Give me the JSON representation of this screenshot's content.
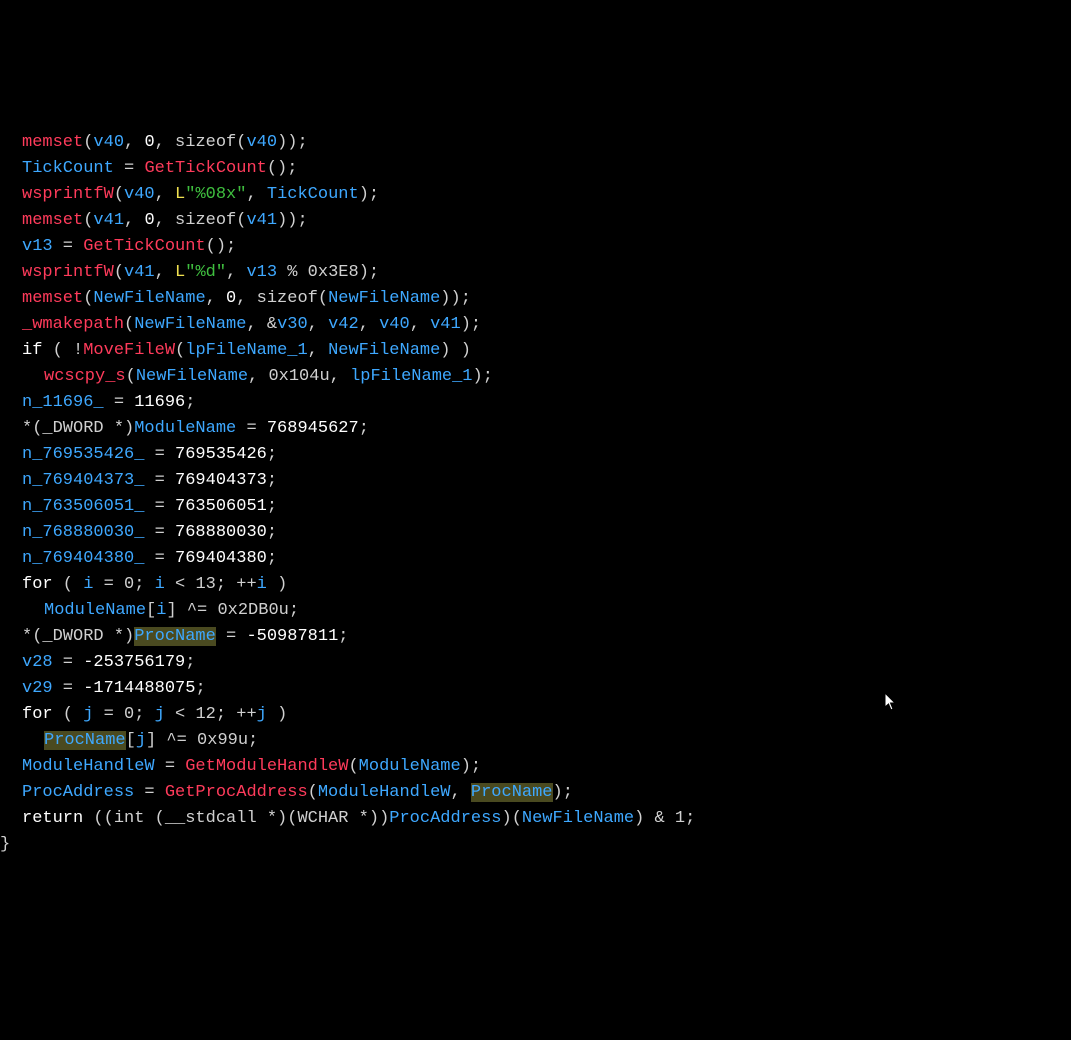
{
  "code": {
    "memset": "memset",
    "v40": "v40",
    "sizeof": "sizeof",
    "TickCount": "TickCount",
    "GetTickCount": "GetTickCount",
    "wsprintfW": "wsprintfW",
    "L": "L",
    "fmt08x": "\"%08x\"",
    "v41": "v41",
    "v13": "v13",
    "fmtd": "\"%d\"",
    "mod0x3E8": " % 0x3E8",
    "NewFileName": "NewFileName",
    "_wmakepath": "_wmakepath",
    "v30": "v30",
    "v42": "v42",
    "if": "if",
    "not": "!",
    "MoveFileW": "MoveFileW",
    "lpFileName_1": "lpFileName_1",
    "wcscpy_s": "wcscpy_s",
    "hex104u": "0x104u",
    "n_11696_": "n_11696_",
    "val11696": "11696",
    "dwordcast": "*(_DWORD *)",
    "ModuleName": "ModuleName",
    "val768945627": "768945627",
    "n_769535426_": "n_769535426_",
    "val769535426": "769535426",
    "n_769404373_": "n_769404373_",
    "val769404373": "769404373",
    "n_763506051_": "n_763506051_",
    "val763506051": "763506051",
    "n_768880030_": "n_768880030_",
    "val768880030": "768880030",
    "n_769404380_": "n_769404380_",
    "val769404380": "769404380",
    "for": "for",
    "i": "i",
    "lt13": " < 13; ++",
    "xor2DB0": " ^= 0x2DB0u;",
    "ProcName": "ProcName",
    "valneg50987811": "-50987811",
    "v28": "v28",
    "valneg253756179": "-253756179",
    "v29": "v29",
    "valneg1714488075": "-1714488075",
    "j": "j",
    "lt12": " < 12; ++",
    "xor99": " ^= 0x99u;",
    "ModuleHandleW": "ModuleHandleW",
    "GetModuleHandleW": "GetModuleHandleW",
    "ProcAddress": "ProcAddress",
    "GetProcAddress": "GetProcAddress",
    "return": "return",
    "castpart": " ((int (__stdcall *)(WCHAR *))",
    "and1": " & 1;",
    "zero": "0",
    "eq": " = ",
    "eq0": " = 0; ",
    "comma": ", ",
    "lp": "(",
    "rp": ")",
    "lb": "[",
    "rb": "]",
    "semi": ";",
    "amp": "&",
    "closeparen2semi": "));",
    "closeparensemi": "();",
    "close1semi": ");",
    "close1sp": ") )",
    "space": " ",
    "rbrace": "}"
  }
}
